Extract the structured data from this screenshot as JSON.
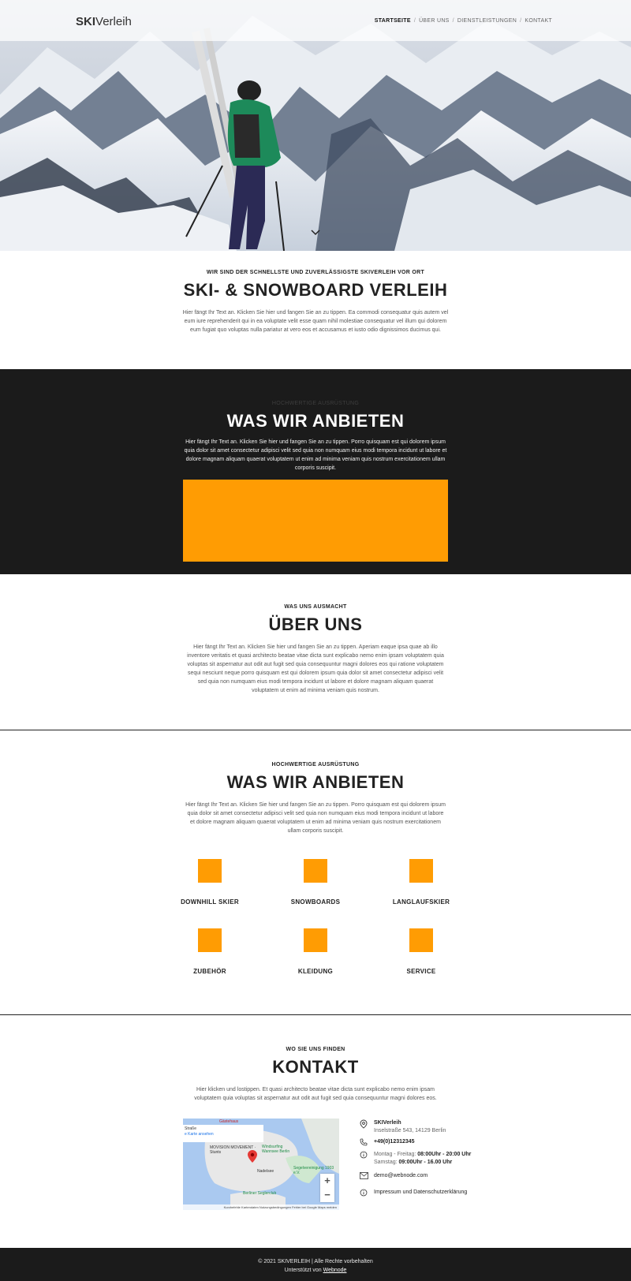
{
  "header": {
    "logo_bold": "SKI",
    "logo_light": "Verleih",
    "nav": [
      "STARTSEITE",
      "ÜBER UNS",
      "DIENSTLEISTUNGEN",
      "KONTAKT"
    ],
    "nav_separator": "/"
  },
  "intro": {
    "eyebrow": "WIR SIND DER SCHNELLSTE UND ZUVERLÄSSIGSTE SKIVERLEIH VOR ORT",
    "title": "SKI- & SNOWBOARD VERLEIH",
    "text": "Hier fängt Ihr Text an. Klicken Sie hier und fangen Sie an zu tippen. Ea commodi consequatur quis autem vel eum iure reprehenderit qui in ea voluptate velit esse quam nihil molestiae consequatur vel illum qui dolorem eum fugiat quo voluptas nulla pariatur at vero eos et accusamus et iusto odio dignissimos ducimus qui."
  },
  "offer_dark": {
    "eyebrow": "HOCHWERTIGE AUSRÜSTUNG",
    "title": "WAS WIR ANBIETEN",
    "text": "Hier fängt Ihr Text an. Klicken Sie hier und fangen Sie an zu tippen. Porro quisquam est qui dolorem ipsum quia dolor sit amet consectetur adipisci velit sed quia non numquam eius modi tempora incidunt ut labore et dolore magnam aliquam quaerat voluptatem ut enim ad minima veniam quis nostrum exercitationem ullam corporis suscipit."
  },
  "about": {
    "eyebrow": "WAS UNS AUSMACHT",
    "title": "ÜBER UNS",
    "text": "Hier fängt Ihr Text an. Klicken Sie hier und fangen Sie an zu tippen. Aperiam eaque ipsa quae ab illo inventore veritatis et quasi architecto beatae vitae dicta sunt explicabo nemo enim ipsam voluptatem quia voluptas sit aspernatur aut odit aut fugit sed quia consequuntur magni dolores eos qui ratione voluptatem sequi nesciunt neque porro quisquam est qui dolorem ipsum quia dolor sit amet consectetur adipisci velit sed quia non numquam eius modi tempora incidunt ut labore et dolore magnam aliquam quaerat voluptatem ut enim ad minima veniam quis nostrum."
  },
  "offer": {
    "eyebrow": "HOCHWERTIGE AUSRÜSTUNG",
    "title": "WAS WIR ANBIETEN",
    "text": "Hier fängt Ihr Text an. Klicken Sie hier und fangen Sie an zu tippen. Porro quisquam est qui dolorem ipsum quia dolor sit amet consectetur adipisci velit sed quia non numquam eius modi tempora incidunt ut labore et dolore magnam aliquam quaerat voluptatem ut enim ad minima veniam quis nostrum exercitationem ullam corporis suscipit.",
    "services": [
      "DOWNHILL SKIER",
      "SNOWBOARDS",
      "LANGLAUFSKIER",
      "ZUBEHÖR",
      "KLEIDUNG",
      "SERVICE"
    ],
    "accent": "#ff9c03"
  },
  "contact": {
    "eyebrow": "WO SIE UNS FINDEN",
    "title": "KONTAKT",
    "text": "Hier klicken und lostippen. Et quasi architecto beatae vitae dicta sunt explicabo nemo enim ipsam voluptatem quia voluptas sit aspernatur aut odit aut fugit sed quia consequuntur magni dolores eos.",
    "map": {
      "info_line1": "Straße",
      "info_link": "e Karte ansehen",
      "label_gastehaus": "Gästehaus",
      "label_movision": "MOVISION MOVEMENT · Stunts",
      "label_wassersport": "Windsurfing Wannsee Berlin",
      "label_segel": "Segelvereinigung 1903 e.V.",
      "label_nadelsee": "Nadelsee",
      "label_berlin": "Berliner Seglerclub",
      "zoom_in": "+",
      "zoom_out": "−",
      "attribution": "Kurzbefehle   Kartendaten   Nutzungsbedingungen   Fehler bei Google Maps melden"
    },
    "company": "SKIVerleih",
    "address": "Inselstraße 543, 14129 Berlin",
    "phone": "+49(0)12312345",
    "hours_line1_label": "Montag - Freitag:",
    "hours_line1_value": "08:00Uhr - 20:00 Uhr",
    "hours_line2_label": "Samstag:",
    "hours_line2_value": "09:00Uhr - 16.00 Uhr",
    "email": "demo@webnode.com",
    "legal": "Impressum und Datenschutzerklärung"
  },
  "footer": {
    "copyright": "© 2021 SKIVERLEIH | Alle Rechte vorbehalten",
    "powered_prefix": "Unterstützt von",
    "powered_link": "Webnode"
  }
}
